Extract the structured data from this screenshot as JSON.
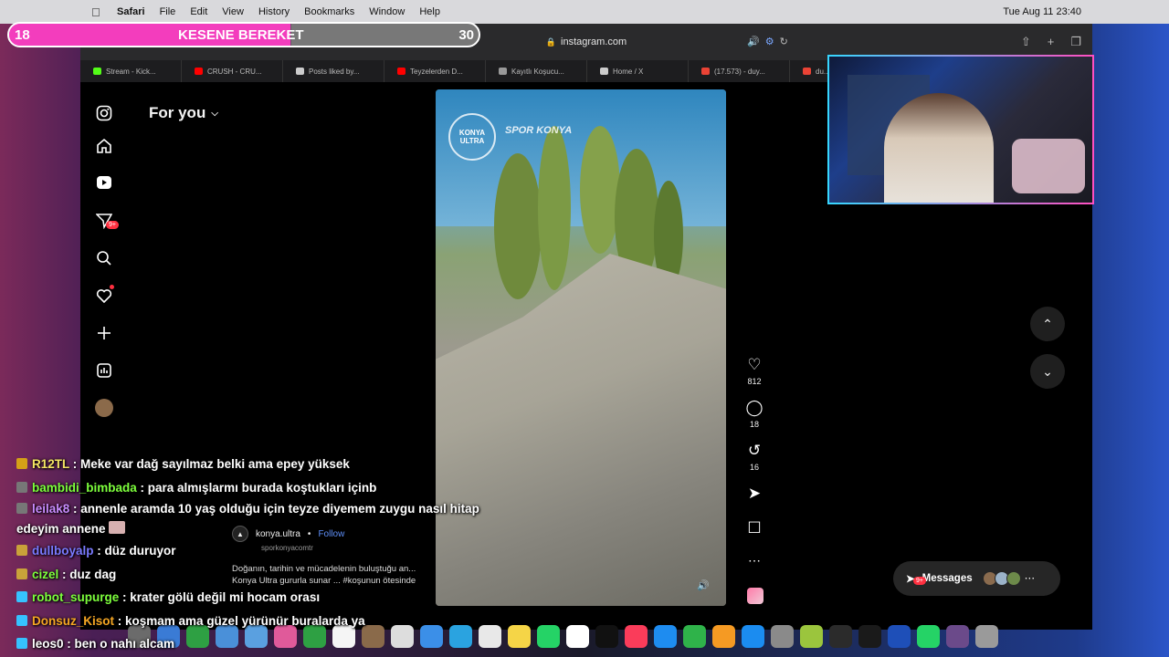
{
  "menubar": {
    "app": "Safari",
    "items": [
      "File",
      "Edit",
      "View",
      "History",
      "Bookmarks",
      "Window",
      "Help"
    ],
    "clock": "Tue Aug 11  23:40"
  },
  "browser": {
    "url": "instagram.com",
    "tabs": [
      {
        "label": "Stream - Kick...",
        "color": "#53fc18"
      },
      {
        "label": "CRUSH - CRU...",
        "color": "#ff0000"
      },
      {
        "label": "Posts liked by...",
        "color": "#cccccc"
      },
      {
        "label": "Teyzelerden D...",
        "color": "#ff0000"
      },
      {
        "label": "Kayıtlı Koşucu...",
        "color": "#999999"
      },
      {
        "label": "Home / X",
        "color": "#cccccc"
      },
      {
        "label": "(17.573) - duy...",
        "color": "#ea4335"
      },
      {
        "label": "du...",
        "color": "#ea4335"
      }
    ]
  },
  "instagram": {
    "feed_title": "For you",
    "nav_badge": "9+",
    "reel": {
      "logo_text": "KONYA ULTRA",
      "brand_text": "SPOR KONYA"
    },
    "actions": {
      "likes": "812",
      "comments": "18",
      "reposts": "16"
    },
    "post": {
      "username": "konya.ultra",
      "follow_label": "Follow",
      "collab": "sporkonyacomtr",
      "caption": "Doğanın, tarihin ve mücadelenin buluştuğu an... Konya Ultra gururla sunar ... #koşunun ötesinde"
    },
    "messages_label": "Messages",
    "messages_badge": "9+"
  },
  "overlay": {
    "goal_title": "KESENE BEREKET",
    "goal_current": "18",
    "goal_target": "30",
    "goal_progress": 0.6
  },
  "chat": [
    {
      "user": "R12TL",
      "color": "#f5e663",
      "icon": "#d4a017",
      "text": "Meke var dağ sayılmaz belki ama epey yüksek"
    },
    {
      "user": "bambidi_bimbada",
      "color": "#7dff3c",
      "icon": "#777777",
      "text": "para almışlarmı burada koştukları içinb"
    },
    {
      "user": "leilak8",
      "color": "#c98cff",
      "icon": "#777777",
      "text": "annenle aramda 10 yaş olduğu için teyze diyemem zuygu nasıl hitap edeyim annene"
    },
    {
      "user": "dullboyalp",
      "color": "#7a7aff",
      "icon": "#c9a23a",
      "text": "düz duruyor"
    },
    {
      "user": "cizel",
      "color": "#7dff3c",
      "icon": "#c9a23a",
      "text": "duz dag"
    },
    {
      "user": "robot_supurge",
      "color": "#7dff3c",
      "icon": "#36c2ff",
      "text": "krater gölü değil mi hocam orası"
    },
    {
      "user": "Donsuz_Kisot",
      "color": "#f5a623",
      "icon": "#36c2ff",
      "text": "koşmam ama güzel yürünür buralarda ya"
    },
    {
      "user": "leos0",
      "color": "#ffffff",
      "icon": "#36c2ff",
      "text": "ben o nahı alcam"
    }
  ]
}
